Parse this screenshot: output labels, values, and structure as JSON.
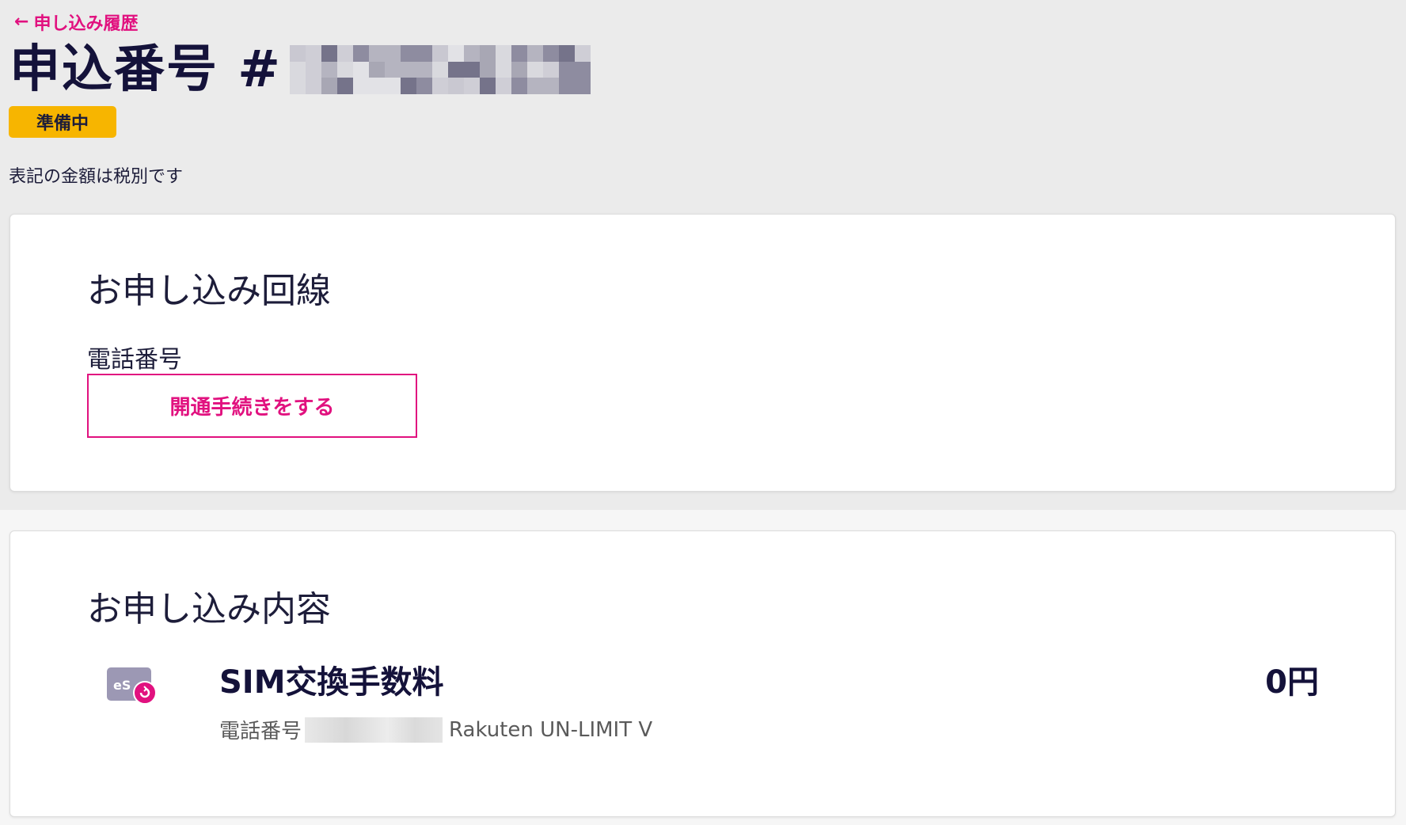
{
  "header": {
    "back_arrow": "←",
    "back_label": "申し込み履歴",
    "title": "申込番号 #",
    "status": "準備中",
    "tax_note": "表記の金額は税別です"
  },
  "line_section": {
    "title": "お申し込み回線",
    "phone_label": "電話番号",
    "activate_button": "開通手続きをする"
  },
  "content_section": {
    "title": "お申し込み内容",
    "item": {
      "icon": "esim-reissue-icon",
      "name": "SIM交換手数料",
      "price": "0円",
      "detail_prefix": "電話番号",
      "plan": "Rakuten UN-LIMIT V"
    }
  },
  "colors": {
    "accent": "#e1117f",
    "status": "#f7b500",
    "title": "#14123a"
  }
}
